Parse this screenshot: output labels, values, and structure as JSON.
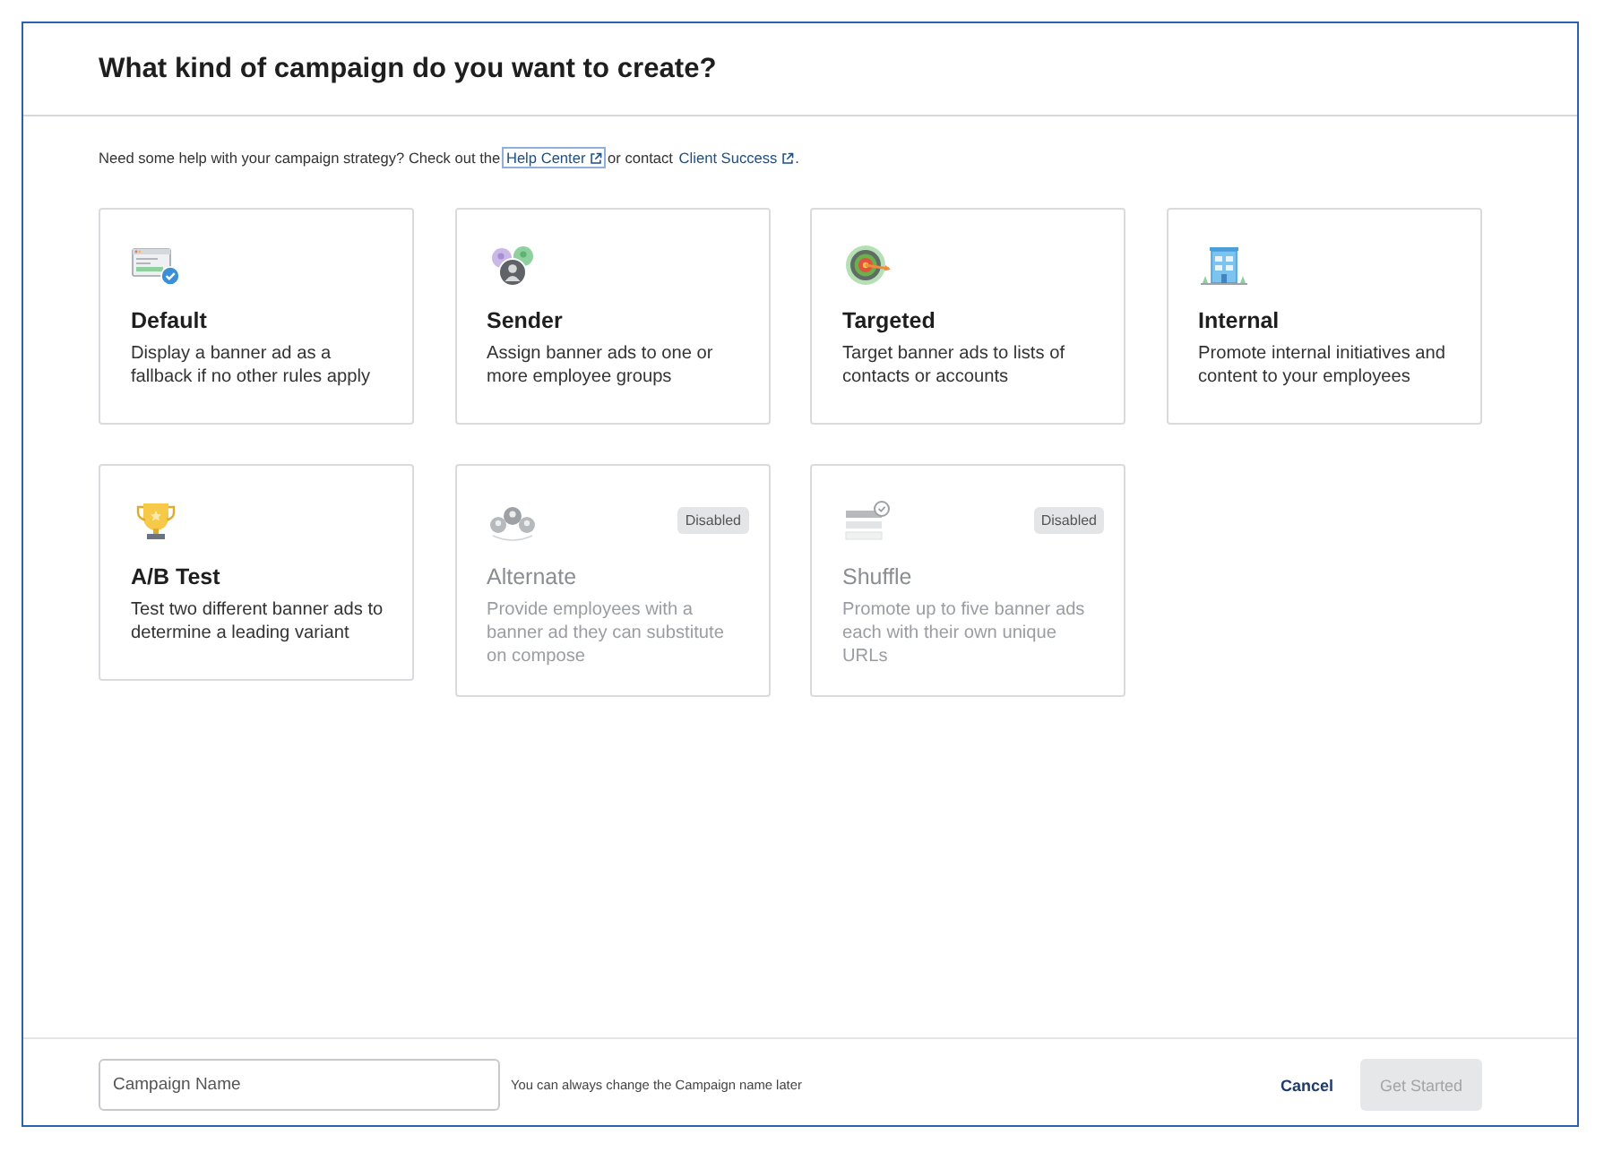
{
  "dialog": {
    "title": "What kind of campaign do you want to create?"
  },
  "intro": {
    "parts": [
      {
        "kind": "text",
        "text": "Need some help with your campaign strategy? Check out the "
      },
      {
        "kind": "link",
        "text": "Help Center",
        "focused": true
      },
      {
        "kind": "text",
        "text": " or contact "
      },
      {
        "kind": "link",
        "text": "Client Success",
        "focused": false
      },
      {
        "kind": "text",
        "text": "."
      }
    ]
  },
  "cards": [
    {
      "kind": "banner",
      "title": "Default",
      "description": "Display a banner ad as a fallback if no other rules apply",
      "disabled": false
    },
    {
      "kind": "people",
      "title": "Sender",
      "description": "Assign banner ads to one or more employee groups",
      "disabled": false
    },
    {
      "kind": "target",
      "title": "Targeted",
      "description": "Target banner ads to lists of contacts or accounts",
      "disabled": false
    },
    {
      "kind": "building",
      "title": "Internal",
      "description": "Promote internal initiatives and content to your employees",
      "disabled": false
    },
    {
      "kind": "trophy",
      "title": "A/B Test",
      "description": "Test two different banner ads to determine a leading variant",
      "disabled": false
    },
    {
      "kind": "group",
      "title": "Alternate",
      "description": "Provide employees with a banner ad they can substitute on compose",
      "disabled": true,
      "badge": "Disabled"
    },
    {
      "kind": "rows",
      "title": "Shuffle",
      "description": "Promote up to five banner ads each with their own unique URLs",
      "disabled": true,
      "badge": "Disabled"
    }
  ],
  "footer": {
    "name_field": {
      "placeholder": "Campaign Name"
    },
    "hint": "You can always change the Campaign name later",
    "cancel": "Cancel",
    "submit": {
      "label": "Get Started",
      "disabled": true
    }
  }
}
